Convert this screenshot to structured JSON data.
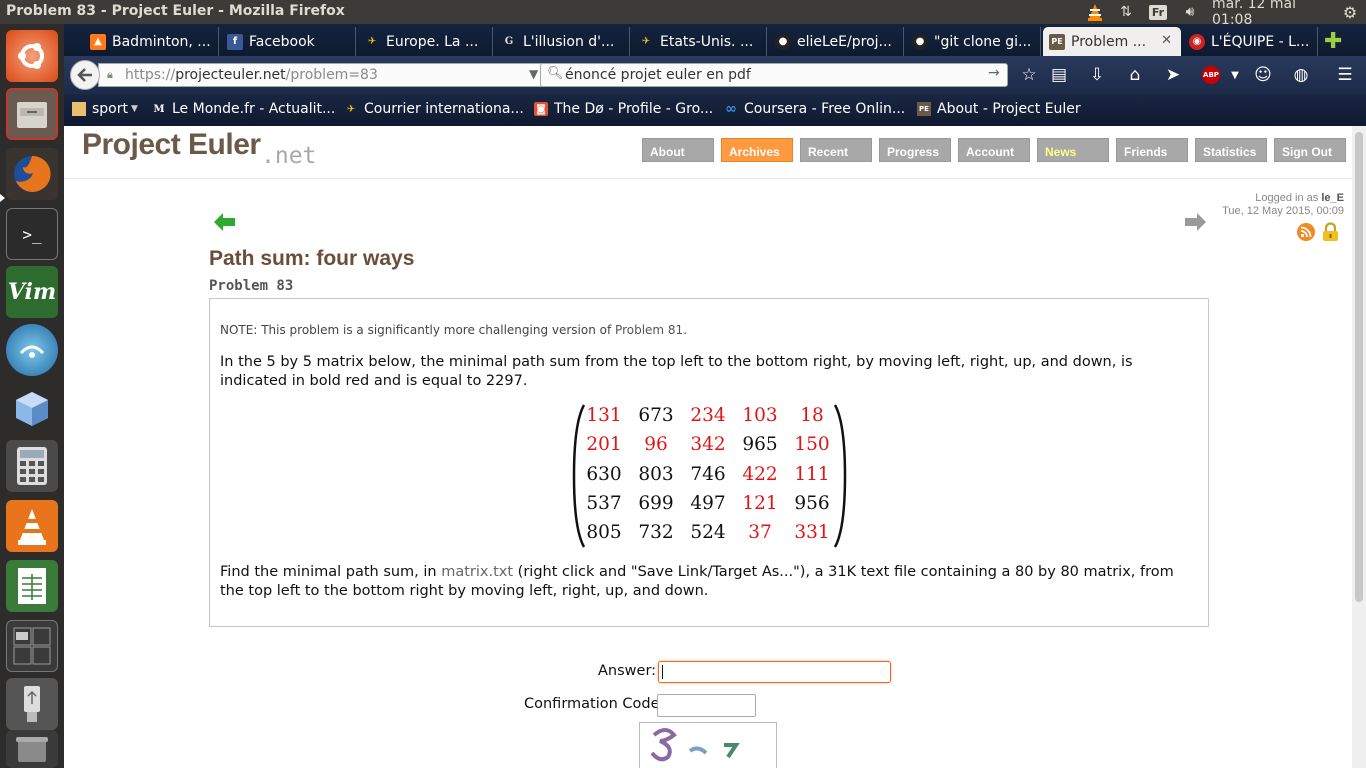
{
  "top_panel": {
    "window_title": "Problem 83 - Project Euler - Mozilla Firefox",
    "keyboard_layout": "Fr",
    "datetime": "mar. 12 mai 01:08"
  },
  "launcher": {
    "items": [
      "ubuntu-dash",
      "files",
      "firefox",
      "terminal",
      "vim",
      "network",
      "virtualbox",
      "calculator",
      "vlc",
      "spreadsheet",
      "workspaces",
      "usb-drive",
      "trash"
    ]
  },
  "tabs": [
    {
      "label": "Badminton, ...",
      "fav": "▲",
      "fav_color": "#ff7a1a"
    },
    {
      "label": "Facebook",
      "fav": "f",
      "fav_color": "#3b5998"
    },
    {
      "label": "Europe. La ...",
      "fav": "✈",
      "fav_color": "#f0d000"
    },
    {
      "label": "L'illusion d'...",
      "fav": "G",
      "fav_color": "#666666"
    },
    {
      "label": "Etats-Unis. ...",
      "fav": "✈",
      "fav_color": "#f0d000"
    },
    {
      "label": "elieLeE/proj...",
      "fav": "●",
      "fav_color": "#333333"
    },
    {
      "label": "\"git clone gi...",
      "fav": "●",
      "fav_color": "#333333"
    },
    {
      "label": "Problem ...",
      "fav": "PE",
      "fav_color": "#6b5a48",
      "active": true
    },
    {
      "label": "L'ÉQUIPE - L...",
      "fav": "◉",
      "fav_color": "#d02020"
    }
  ],
  "navbar": {
    "url_prefix": "https://",
    "url_host": "projecteuler.net",
    "url_path": "/problem=83",
    "search_value": "énoncé projet euler en pdf"
  },
  "bookmarks": [
    {
      "label": "sport",
      "fav": "▇",
      "fav_color": "#e8c070",
      "has_dropdown": true
    },
    {
      "label": "Le Monde.fr - Actualit...",
      "fav": "M",
      "fav_color": "#ffffff"
    },
    {
      "label": "Courrier internationa...",
      "fav": "✈",
      "fav_color": "#f0d000"
    },
    {
      "label": "The Dø - Profile - Gro...",
      "fav": "◙",
      "fav_color": "#e85030"
    },
    {
      "label": "Coursera - Free Onlin...",
      "fav": "∞",
      "fav_color": "#3a8ee6"
    },
    {
      "label": "About - Project Euler",
      "fav": "PE",
      "fav_color": "#6b5a48"
    }
  ],
  "site": {
    "logo": "Project Euler",
    "logo_suffix": ".net",
    "menu": [
      "About",
      "Archives",
      "Recent",
      "Progress",
      "Account",
      "News",
      "Friends",
      "Statistics",
      "Sign Out"
    ],
    "active_menu": "Archives",
    "logged_in_prefix": "Logged in as",
    "username": "le_E",
    "login_time": "Tue, 12 May 2015, 00:09"
  },
  "problem": {
    "title": "Path sum: four ways",
    "number": "Problem 83",
    "note_prefix": "NOTE: This problem is a significantly more challenging version of",
    "note_link": "Problem 81",
    "note_suffix": ".",
    "para1": "In the 5 by 5 matrix below, the minimal path sum from the top left to the bottom right, by moving left, right, up, and down, is indicated in bold red and is equal to 2297.",
    "matrix": [
      [
        131,
        673,
        234,
        103,
        18
      ],
      [
        201,
        96,
        342,
        965,
        150
      ],
      [
        630,
        803,
        746,
        422,
        111
      ],
      [
        537,
        699,
        497,
        121,
        956
      ],
      [
        805,
        732,
        524,
        37,
        331
      ]
    ],
    "highlight": [
      [
        true,
        false,
        true,
        true,
        true
      ],
      [
        true,
        true,
        true,
        false,
        true
      ],
      [
        false,
        false,
        false,
        true,
        true
      ],
      [
        false,
        false,
        false,
        true,
        false
      ],
      [
        false,
        false,
        false,
        true,
        true
      ]
    ],
    "para2_prefix": "Find the minimal path sum, in",
    "para2_link": "matrix.txt",
    "para2_suffix": "(right click and \"Save Link/Target As...\"), a 31K text file containing a 80 by 80 matrix, from the top left to the bottom right by moving left, right, up, and down."
  },
  "form": {
    "answer_label": "Answer:",
    "answer_value": "",
    "confirm_label": "Confirmation Code:",
    "confirm_value": ""
  }
}
